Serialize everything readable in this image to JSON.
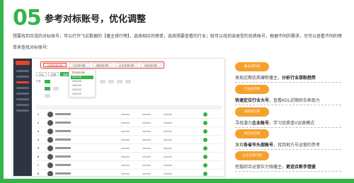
{
  "header": {
    "number": "05",
    "title": "参考对标账号，优化调整"
  },
  "intro": "想要找到合适的对标账号，可以打开飞瓜数据的【播主排行榜】，选择相应的榜单，选择想要查看的行业；就可以找到该类型的优质账号，根据不同的需求，也可以查看不同的榜单来查找对标账号：",
  "screenshot": {
    "tabs": [
      "抖音号排行榜",
      "行业排行榜",
      "涨粉排行榜",
      "企业号排行榜",
      "地区排行榜"
    ],
    "filter_buttons": [
      "行业",
      "日榜",
      "周榜"
    ],
    "dropdown_items": [
      "昨日排行榜",
      "2024-06",
      "2024-05",
      "2024-04",
      "2024-03",
      "2024-02"
    ],
    "category_label": "行业",
    "ranks": [
      "1",
      "2",
      "3",
      "4",
      "5",
      "6",
      "7",
      "8",
      "9"
    ]
  },
  "features": [
    {
      "pill": "播主排行榜",
      "pre": "发现近期优质爆粉播主，",
      "bold": "分析行业涨粉趋势",
      "post": ""
    },
    {
      "pill": "行业排行榜",
      "pre": "",
      "bold": "快速定位行业大号",
      "post": "，查看KOL近期综合表现力"
    },
    {
      "pill": "涨粉排行榜",
      "pre": "寻找潜力",
      "bold": "企业账号",
      "post": "，学习优质蓝V运营模式"
    },
    {
      "pill": "地区排行榜",
      "pre": "发现",
      "bold": "各省市头部账号",
      "post": "，找到地方号运营的参考"
    },
    {
      "pill": "企业号排行榜",
      "pre": "挖掘综合运营实力强播主，",
      "bold": "更适合新手借鉴",
      "post": ""
    }
  ],
  "colors": {
    "brand_green": "#33b44a",
    "accent_orange": "#f6a12c",
    "highlight_red": "#e8412b"
  }
}
